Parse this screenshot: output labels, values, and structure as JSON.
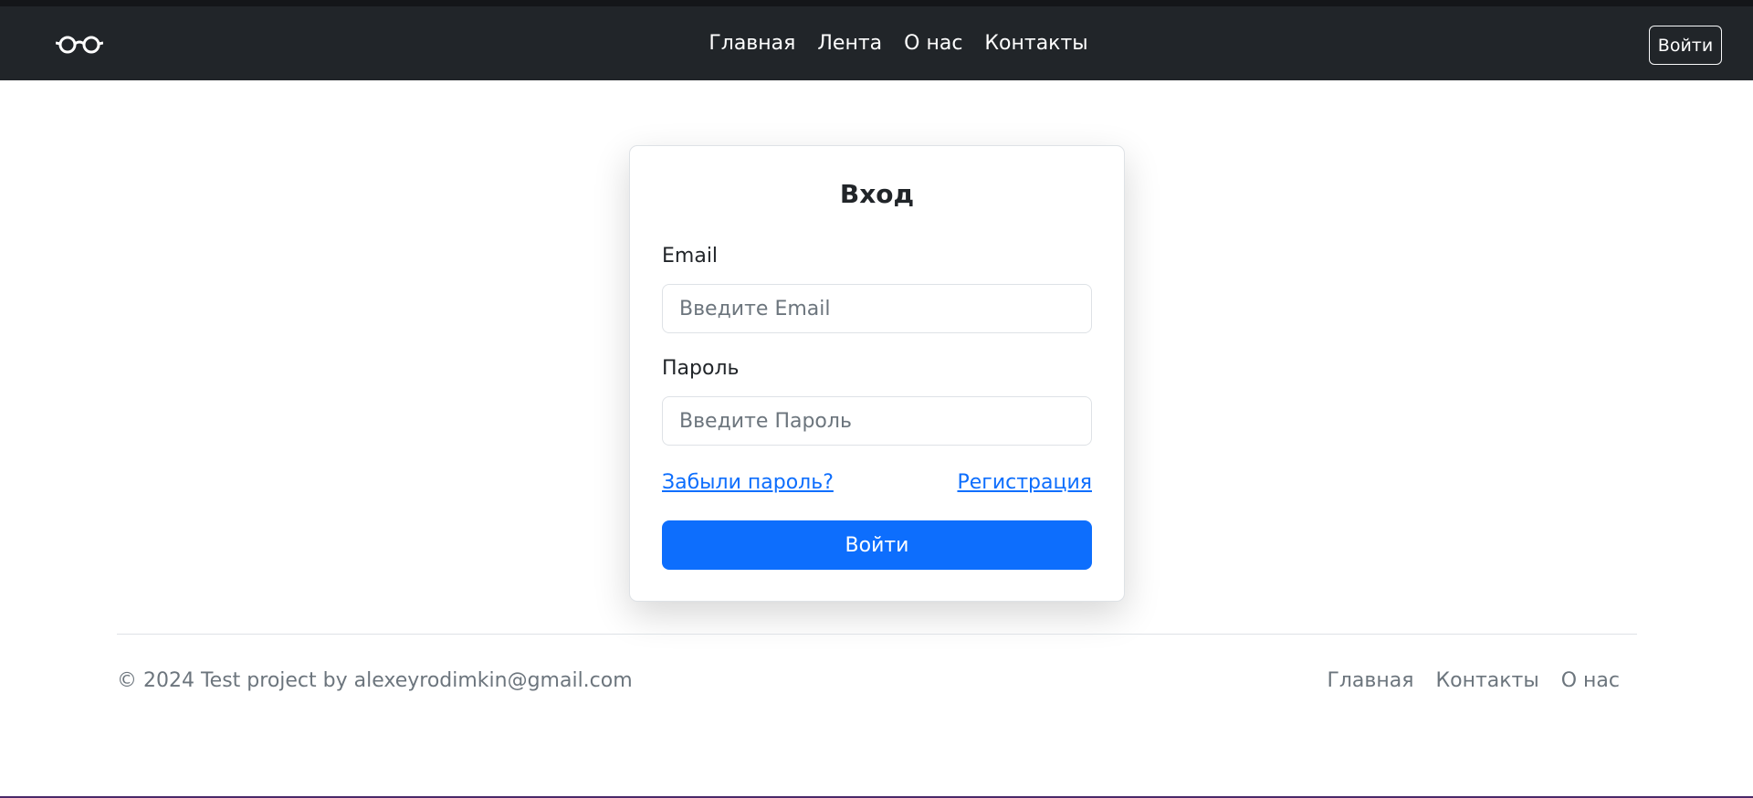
{
  "header": {
    "logo_icon": "glasses-icon",
    "nav": [
      {
        "label": "Главная"
      },
      {
        "label": "Лента"
      },
      {
        "label": "О нас"
      },
      {
        "label": "Контакты"
      }
    ],
    "login_label": "Войти"
  },
  "login_form": {
    "title": "Вход",
    "email_label": "Email",
    "email_placeholder": "Введите Email",
    "email_value": "",
    "password_label": "Пароль",
    "password_placeholder": "Введите Пароль",
    "password_value": "",
    "forgot_label": "Забыли пароль?",
    "register_label": "Регистрация",
    "submit_label": "Войти"
  },
  "footer": {
    "copyright": "© 2024 Test project by alexeyrodimkin@gmail.com",
    "links": [
      {
        "label": "Главная"
      },
      {
        "label": "Контакты"
      },
      {
        "label": "О нас"
      }
    ]
  },
  "colors": {
    "navbar_bg": "#212529",
    "primary": "#0d6efd",
    "muted_text": "#6c757d"
  }
}
